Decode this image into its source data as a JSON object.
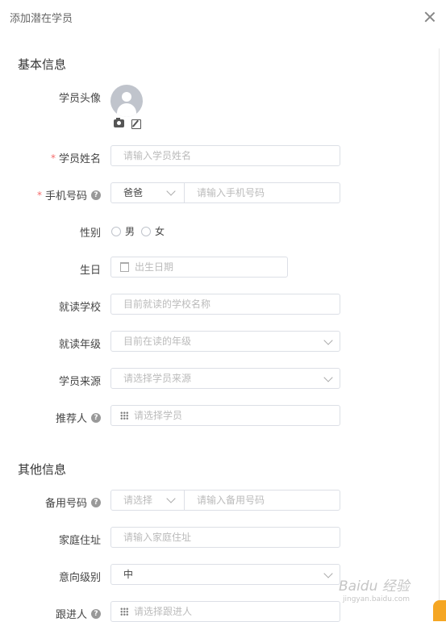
{
  "dialog": {
    "title": "添加潜在学员"
  },
  "sections": {
    "basic": "基本信息",
    "other": "其他信息"
  },
  "fields": {
    "avatar": {
      "label": "学员头像"
    },
    "name": {
      "label": "学员姓名",
      "placeholder": "请输入学员姓名"
    },
    "phone": {
      "label": "手机号码",
      "relation": "爸爸",
      "placeholder": "请输入手机号码"
    },
    "gender": {
      "label": "性别",
      "options": [
        "男",
        "女"
      ]
    },
    "birthday": {
      "label": "生日",
      "placeholder": "出生日期"
    },
    "school": {
      "label": "就读学校",
      "placeholder": "目前就读的学校名称"
    },
    "grade": {
      "label": "就读年级",
      "placeholder": "目前在读的年级"
    },
    "source": {
      "label": "学员来源",
      "placeholder": "请选择学员来源"
    },
    "referrer": {
      "label": "推荐人",
      "placeholder": "请选择学员"
    },
    "backup_phone": {
      "label": "备用号码",
      "relation_placeholder": "请选择",
      "placeholder": "请输入备用号码"
    },
    "address": {
      "label": "家庭住址",
      "placeholder": "请输入家庭住址"
    },
    "intent": {
      "label": "意向级别",
      "value": "中"
    },
    "follower": {
      "label": "跟进人",
      "placeholder": "请选择跟进人"
    }
  },
  "watermark": {
    "text": "Baidu 经验",
    "sub": "jingyan.baidu.com"
  },
  "colors": {
    "required": "#f56c6c",
    "border": "#dcdfe6",
    "avatar_bg": "#c0c4cc"
  }
}
